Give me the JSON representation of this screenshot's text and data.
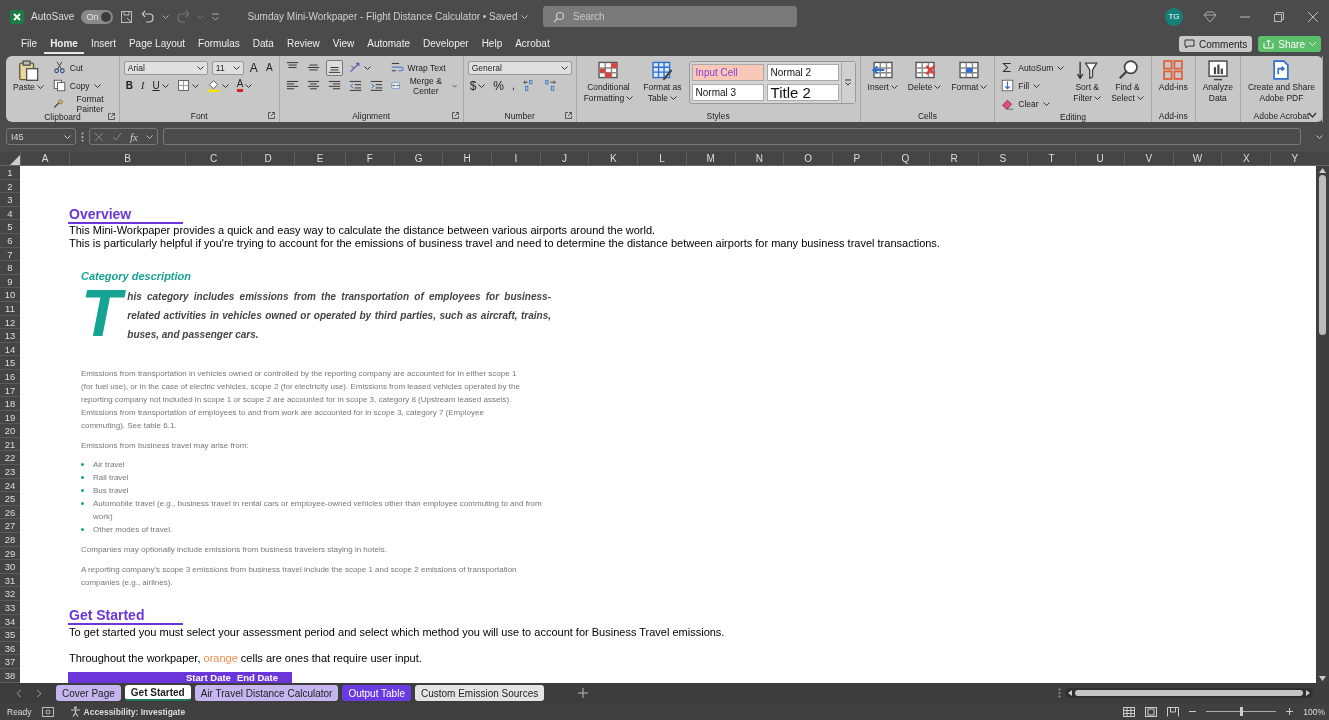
{
  "title_bar": {
    "autosave": {
      "label": "AutoSave",
      "state_label": "On",
      "on": true
    },
    "document_title": "Sumday Mini-Workpaper - Flight Distance Calculator • Saved",
    "search": {
      "placeholder": "Search"
    },
    "avatar": "TG"
  },
  "menu_tabs": [
    {
      "label": "File",
      "selected": false
    },
    {
      "label": "Home",
      "selected": true
    },
    {
      "label": "Insert",
      "selected": false
    },
    {
      "label": "Page Layout",
      "selected": false
    },
    {
      "label": "Formulas",
      "selected": false
    },
    {
      "label": "Data",
      "selected": false
    },
    {
      "label": "Review",
      "selected": false
    },
    {
      "label": "View",
      "selected": false
    },
    {
      "label": "Automate",
      "selected": false
    },
    {
      "label": "Developer",
      "selected": false
    },
    {
      "label": "Help",
      "selected": false
    },
    {
      "label": "Acrobat",
      "selected": false
    }
  ],
  "header_buttons": [
    {
      "label": "Comments",
      "kind": "comments"
    },
    {
      "label": "Share",
      "kind": "share"
    }
  ],
  "ribbon": {
    "groups": [
      {
        "label": "Clipboard",
        "launcher": true,
        "items": [
          {
            "kind": "large",
            "lines": [
              "Paste"
            ],
            "menu": true
          },
          {
            "kind": "stack",
            "tiers": [
              [
                {
                  "kind": "small",
                  "label": "Cut"
                }
              ],
              [
                {
                  "kind": "small",
                  "label": "Copy",
                  "menu": true
                }
              ],
              [
                {
                  "kind": "small",
                  "label": "Format Painter"
                }
              ]
            ]
          }
        ]
      },
      {
        "label": "Font",
        "launcher": true,
        "items": [
          {
            "kind": "stack",
            "tiers": [
              [
                {
                  "kind": "dropdown",
                  "value": "Arial"
                },
                {
                  "kind": "dropdown",
                  "value": "11"
                },
                {
                  "kind": "grow",
                  "label": "A"
                },
                {
                  "kind": "shrink",
                  "label": "A"
                }
              ],
              [
                {
                  "kind": "bold",
                  "label": "B"
                },
                {
                  "kind": "italic",
                  "label": "I"
                },
                {
                  "kind": "underline",
                  "label": "U",
                  "menu": true
                },
                {
                  "kind": "icon",
                  "menu": true
                },
                {
                  "kind": "icon",
                  "menu": true
                },
                {
                  "kind": "fontcolor",
                  "label": "A",
                  "menu": true
                }
              ]
            ]
          }
        ]
      },
      {
        "label": "Alignment",
        "launcher": true,
        "items": [
          {
            "kind": "stack",
            "tiers": [
              [
                {
                  "kind": "icon",
                  "selected": false
                },
                {
                  "kind": "icon",
                  "selected": false
                },
                {
                  "kind": "icon",
                  "selected": true
                },
                {
                  "kind": "icon",
                  "menu": true
                }
              ],
              [
                {
                  "kind": "icon",
                  "selected": false
                },
                {
                  "kind": "icon",
                  "selected": false
                },
                {
                  "kind": "icon",
                  "selected": false
                },
                {
                  "kind": "icon"
                },
                {
                  "kind": "icon"
                }
              ]
            ]
          },
          {
            "kind": "stack",
            "tiers": [
              [
                {
                  "kind": "small",
                  "label": "Wrap Text"
                }
              ],
              [
                {
                  "kind": "small",
                  "label": "Merge & Center",
                  "menu": true
                }
              ]
            ]
          }
        ]
      },
      {
        "label": "Number",
        "launcher": true,
        "items": [
          {
            "kind": "stack",
            "tiers": [
              [
                {
                  "kind": "dropdown",
                  "value": "General"
                }
              ],
              [
                {
                  "kind": "glyph",
                  "label": "$",
                  "menu": true
                },
                {
                  "kind": "glyph",
                  "label": "%"
                },
                {
                  "kind": "glyph",
                  "label": ","
                },
                {
                  "kind": "icon"
                },
                {
                  "kind": "icon"
                }
              ]
            ]
          }
        ]
      },
      {
        "label": "Styles",
        "items": [
          {
            "kind": "large",
            "lines": [
              "Conditional",
              "Formatting"
            ],
            "menu": true
          },
          {
            "kind": "large",
            "lines": [
              "Format as",
              "Table"
            ],
            "menu": true
          },
          {
            "kind": "gallery",
            "styles": [
              {
                "label": "Input Cell",
                "kind": "input"
              },
              {
                "label": "Normal 2",
                "kind": "normal"
              },
              {
                "label": "Normal 3",
                "kind": "normal"
              },
              {
                "label": "Title 2",
                "kind": "title"
              }
            ]
          }
        ]
      },
      {
        "label": "Cells",
        "items": [
          {
            "kind": "large",
            "lines": [
              "Insert"
            ],
            "menu": true
          },
          {
            "kind": "large",
            "lines": [
              "Delete"
            ],
            "menu": true
          },
          {
            "kind": "large",
            "lines": [
              "Format"
            ],
            "menu": true
          }
        ]
      },
      {
        "label": "Editing",
        "items": [
          {
            "kind": "stack",
            "tiers": [
              [
                {
                  "kind": "small",
                  "label": "AutoSum",
                  "menu": true
                }
              ],
              [
                {
                  "kind": "small",
                  "label": "Fill",
                  "menu": true
                }
              ],
              [
                {
                  "kind": "small",
                  "label": "Clear",
                  "menu": true
                }
              ]
            ]
          },
          {
            "kind": "large",
            "lines": [
              "Sort &",
              "Filter"
            ],
            "menu": true
          },
          {
            "kind": "large",
            "lines": [
              "Find &",
              "Select"
            ],
            "menu": true
          }
        ]
      },
      {
        "label": "Add-ins",
        "items": [
          {
            "kind": "large",
            "lines": [
              "Add-ins"
            ]
          }
        ]
      },
      {
        "items": [
          {
            "kind": "large",
            "lines": [
              "Analyze",
              "Data"
            ]
          }
        ]
      },
      {
        "label": "Adobe Acrobat",
        "items": [
          {
            "kind": "large",
            "lines": [
              "Create and Share",
              "Adobe PDF"
            ]
          }
        ]
      }
    ]
  },
  "formula_bar": {
    "name_box": "I45",
    "function_label": "fx"
  },
  "sheet": {
    "columns": [
      "A",
      "B",
      "C",
      "D",
      "E",
      "F",
      "G",
      "H",
      "I",
      "J",
      "K",
      "L",
      "M",
      "N",
      "O",
      "P",
      "Q",
      "R",
      "S",
      "T",
      "U",
      "V",
      "W",
      "X",
      "Y"
    ],
    "rows": [
      "1",
      "2",
      "3",
      "4",
      "5",
      "6",
      "7",
      "8",
      "9",
      "10",
      "11",
      "12",
      "13",
      "14",
      "15",
      "16",
      "17",
      "18",
      "19",
      "20",
      "21",
      "22",
      "23",
      "24",
      "25",
      "26",
      "27",
      "28",
      "29",
      "30",
      "31",
      "32",
      "33",
      "34",
      "35",
      "36",
      "37",
      "38"
    ],
    "overview": {
      "heading": "Overview",
      "lines": [
        "This Mini-Workpaper provides a quick and easy way to calculate the distance between various airports around the world.",
        "This is particularly helpful if you're trying to account for the emissions of business travel and need to determine the distance between airports for many business travel transactions."
      ]
    },
    "category": {
      "title": "Category description",
      "drop_cap": "T",
      "lead": "his category includes emissions from the transportation of employees for business-related activities in vehicles owned or operated by third parties, such as aircraft, trains, buses, and passenger cars.",
      "body": [
        {
          "kind": "para",
          "text": "Emissions from transportation in vehicles owned or controlled by the reporting company are accounted for in either scope 1 (for fuel use), or in the case of electric vehicles, scope 2 (for electricity use). Emissions from leased vehicles operated by the reporting company not included in scope 1 or scope 2 are accounted for in scope 3, category 8 (Upstream leased assets). Emissions from transportation of employees to and from work are accounted for in scope 3, category 7 (Employee commuting). See table 6.1."
        },
        {
          "kind": "para",
          "text": "Emissions from business travel may arise from:"
        },
        {
          "kind": "bullets",
          "items": [
            "Air travel",
            "Rail travel",
            "Bus travel",
            "Automobile travel (e.g., business travel in rental cars or employee-owned vehicles other than employee commuting to and from work)",
            "Other modes of travel."
          ]
        },
        {
          "kind": "para",
          "text": "Companies may optionally include emissions from business travelers staying in hotels."
        },
        {
          "kind": "para",
          "text": "A reporting company's scope 3 emissions from business travel include the scope 1 and scope 2 emissions of transportation companies (e.g., airlines)."
        }
      ]
    },
    "get_started": {
      "heading": "Get Started",
      "lines": [
        [
          {
            "text": "To get started you must select your assessment period and select which method you will use to account for Business Travel emissions.",
            "kind": "plain"
          }
        ],
        [
          {
            "text": "Throughout the workpaper, ",
            "kind": "plain"
          },
          {
            "text": "orange",
            "kind": "highlight"
          },
          {
            "text": " cells are ones that require user input.",
            "kind": "plain"
          }
        ]
      ],
      "table_header": [
        "Start Date",
        "End Date"
      ]
    }
  },
  "sheet_tabs": [
    {
      "label": "Cover Page",
      "selected": false,
      "color": "#c6b6f0"
    },
    {
      "label": "Get Started",
      "selected": true
    },
    {
      "label": "Air Travel Distance Calculator",
      "selected": false,
      "color": "#c6b6f0"
    },
    {
      "label": "Output Table",
      "selected": false,
      "color": "#6a3be0"
    },
    {
      "label": "Custom Emission Sources",
      "selected": false,
      "color": "#e4e4e4"
    }
  ],
  "status_bar": {
    "status": "Ready",
    "accessibility": "Accessibility: Investigate",
    "zoom": {
      "level": 0.5,
      "label": "100%"
    }
  }
}
